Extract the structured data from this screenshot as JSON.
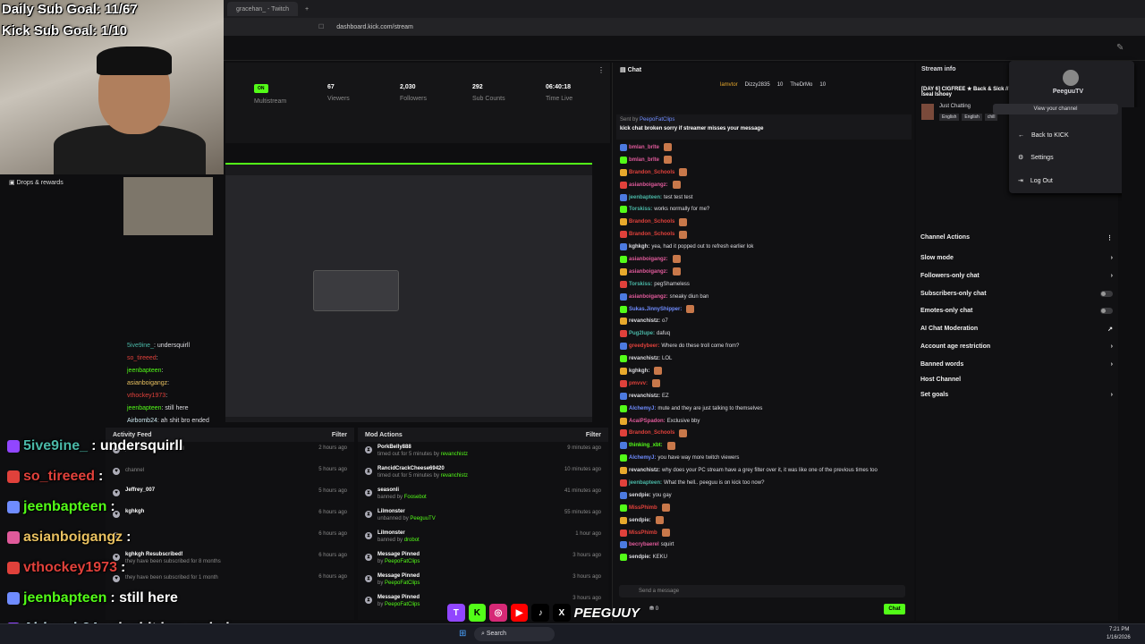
{
  "overlay": {
    "daily_goal": "Daily Sub Goal: 11/67",
    "kick_goal": "Kick Sub Goal: 1/10"
  },
  "browser": {
    "tab_title": "gracehan_ - Twitch",
    "url": "dashboard.kick.com/stream"
  },
  "drops_label": "Drops & rewards",
  "stats": {
    "on_label": "ON",
    "multistream": "Multistream",
    "viewers_value": "67",
    "viewers_label": "Viewers",
    "followers_value": "2,030",
    "followers_label": "Followers",
    "subs_value": "292",
    "subs_label": "Sub Counts",
    "time_value": "06:40:18",
    "time_label": "Time Live"
  },
  "activity_feed": {
    "title": "Activity Feed",
    "filter": "Filter",
    "rows": [
      {
        "t": "",
        "s": "just followed the channel",
        "time": "2 hours ago"
      },
      {
        "t": "",
        "s": "channel",
        "time": "5 hours ago"
      },
      {
        "t": "Jeffrey_007",
        "s": "",
        "time": "5 hours ago"
      },
      {
        "t": "kghkgh",
        "s": "",
        "time": "6 hours ago"
      },
      {
        "t": "",
        "s": "",
        "time": "6 hours ago"
      },
      {
        "t": "kghkgh Resubscribed!",
        "s": "they have been subscribed for 8 months",
        "time": "6 hours ago"
      },
      {
        "t": "",
        "s": "they have been subscribed for 1 month",
        "time": "6 hours ago"
      }
    ]
  },
  "mod_actions": {
    "title": "Mod Actions",
    "filter": "Filter",
    "rows": [
      {
        "t": "PorkBelly888",
        "s": "timed out for 5 minutes by ",
        "by": "revanchistz",
        "time": "9 minutes ago"
      },
      {
        "t": "RancidCrackCheese69420",
        "s": "timed out for 5 minutes by ",
        "by": "revanchistz",
        "time": "10 minutes ago"
      },
      {
        "t": "seasonli",
        "s": "banned by ",
        "by": "Foosebot",
        "time": "41 minutes ago"
      },
      {
        "t": "Lilmonster",
        "s": "unbanned by ",
        "by": "PeeguuTV",
        "time": "55 minutes ago"
      },
      {
        "t": "Lilmonster",
        "s": "banned by ",
        "by": "drobot",
        "time": "1 hour ago"
      },
      {
        "t": "Message Pinned",
        "s": "by ",
        "by": "PeepoFatClips",
        "time": "3 hours ago"
      },
      {
        "t": "Message Pinned",
        "s": "by ",
        "by": "PeepoFatClips",
        "time": "3 hours ago"
      },
      {
        "t": "Message Pinned",
        "s": "by ",
        "by": "PeepoFatClips",
        "time": "3 hours ago"
      }
    ]
  },
  "chat": {
    "title": "Chat",
    "top_users": [
      "lamvtor",
      "Dizzy2835",
      "TheDrMo"
    ],
    "top_counts": [
      "10",
      "10"
    ],
    "pinned_by": "Sent by ",
    "pinned_user": "PeepoFatClips",
    "pinned_text": "kick chat broken sorry if streamer misses your message",
    "messages": [
      {
        "u": "bmlan_brlte",
        "c": "#e05a9b",
        "m": ""
      },
      {
        "u": "bmlan_brlte",
        "c": "#e05a9b",
        "m": ""
      },
      {
        "u": "Brandon_Schools",
        "c": "#e0413b",
        "m": ""
      },
      {
        "u": "asianboigangz:",
        "c": "#e05a9b",
        "m": ""
      },
      {
        "u": "jeenbapteen:",
        "c": "#4ab8a7",
        "m": "test test test"
      },
      {
        "u": "Torskiss:",
        "c": "#4ab8a7",
        "m": "works normally for me?"
      },
      {
        "u": "Brandon_Schools",
        "c": "#e0413b",
        "m": ""
      },
      {
        "u": "Brandon_Schools",
        "c": "#e0413b",
        "m": ""
      },
      {
        "u": "kghkgh:",
        "c": "#dedee3",
        "m": "yea, had it popped out to refresh earlier lok"
      },
      {
        "u": "asianboigangz:",
        "c": "#e05a9b",
        "m": ""
      },
      {
        "u": "asianboigangz:",
        "c": "#e05a9b",
        "m": ""
      },
      {
        "u": "Torskiss:",
        "c": "#4ab8a7",
        "m": "pegShameless"
      },
      {
        "u": "asianboigangz:",
        "c": "#e05a9b",
        "m": "sneaky diun ban"
      },
      {
        "u": "Sukas.JinnyShipper:",
        "c": "#6f8cff",
        "m": ""
      },
      {
        "u": "revanchistz:",
        "c": "#dedee3",
        "m": "o7"
      },
      {
        "u": "Pug2lupe:",
        "c": "#4ab8a7",
        "m": "dafuq"
      },
      {
        "u": "greedybeer:",
        "c": "#e0413b",
        "m": "Where do these troll come from?"
      },
      {
        "u": "revanchistz:",
        "c": "#dedee3",
        "m": "LOL"
      },
      {
        "u": "kghkgh:",
        "c": "#dedee3",
        "m": ""
      },
      {
        "u": "pmvvv:",
        "c": "#e0413b",
        "m": ""
      },
      {
        "u": "revanchistz:",
        "c": "#dedee3",
        "m": "EZ"
      },
      {
        "u": "AlchemyJ:",
        "c": "#6f8cff",
        "m": "mute and they are just talking to themselves"
      },
      {
        "u": "AcaiPSpadon:",
        "c": "#e05a9b",
        "m": "Exclusive bby"
      },
      {
        "u": "Brandon_Schools",
        "c": "#e0413b",
        "m": ""
      },
      {
        "u": "thinking_xbt:",
        "c": "#53fc18",
        "m": ""
      },
      {
        "u": "AlchemyJ:",
        "c": "#6f8cff",
        "m": "you have way more twitch viewers"
      },
      {
        "u": "revanchistz:",
        "c": "#dedee3",
        "m": "why does your PC stream have a grey filter over it, it was like one of the previous times too"
      },
      {
        "u": "jeenbapteen:",
        "c": "#4ab8a7",
        "m": "What the hell.. peeguu is on kick too now?"
      },
      {
        "u": "sendpie:",
        "c": "#dedee3",
        "m": "you gay"
      },
      {
        "u": "MissPhimb",
        "c": "#e0413b",
        "m": ""
      },
      {
        "u": "sendpie:",
        "c": "#dedee3",
        "m": ""
      },
      {
        "u": "MissPhimb",
        "c": "#e0413b",
        "m": ""
      },
      {
        "u": "becrybaerel",
        "c": "#e05a9b",
        "m": "squirt"
      },
      {
        "u": "sendpie:",
        "c": "#dedee3",
        "m": "KEKU"
      }
    ],
    "send_placeholder": "Send a message",
    "send_count": "0",
    "chat_button": "Chat"
  },
  "stream_info": {
    "title": "Stream info",
    "stream_title": "[DAY 6] CIGFREE ★ Back & Sick // Iseal Ishoey",
    "category": "Just Chatting",
    "tags": [
      "English",
      "English",
      "chill"
    ]
  },
  "dropdown": {
    "name": "PeeguuTV",
    "view_channel": "View your channel",
    "back": "Back to KICK",
    "settings": "Settings",
    "logout": "Log Out"
  },
  "channel_actions": {
    "title": "Channel Actions",
    "items": [
      "Slow mode",
      "Followers-only chat",
      "Subscribers-only chat",
      "Emotes-only chat",
      "AI Chat Moderation",
      "Account age restriction",
      "Banned words",
      "Host Channel",
      "Set goals"
    ]
  },
  "overlay_chat": [
    {
      "u": "5ive9ine_",
      "m": ": undersquirll",
      "c": "#4ab8a7"
    },
    {
      "u": "so_tireeed",
      "m": ":",
      "c": "#e0413b"
    },
    {
      "u": "jeenbapteen",
      "m": ":",
      "c": "#53fc18"
    },
    {
      "u": "asianboigangz",
      "m": ":",
      "c": "#e8c060"
    },
    {
      "u": "vthockey1973",
      "m": ":",
      "c": "#e0413b"
    },
    {
      "u": "jeenbapteen",
      "m": ": still here",
      "c": "#53fc18"
    },
    {
      "u": "Airbomb24",
      "m": ": ah shit bro ended",
      "c": "#cde8f0"
    }
  ],
  "preview_chat": [
    {
      "u": "5ive9ine_",
      "m": ": undersquirll"
    },
    {
      "u": "so_tireeed",
      "m": ":"
    },
    {
      "u": "jeenbapteen",
      "m": ":"
    },
    {
      "u": "asianboigangz",
      "m": ":"
    },
    {
      "u": "vthockey1973",
      "m": ":"
    },
    {
      "u": "jeenbapteen",
      "m": ": still here"
    },
    {
      "u": "Airbomb24",
      "m": ": ah shit bro ended"
    }
  ],
  "taskbar": {
    "search": "Search",
    "time": "7:21 PM",
    "date": "1/16/2026"
  },
  "socials_brand": "PEEGUUY"
}
